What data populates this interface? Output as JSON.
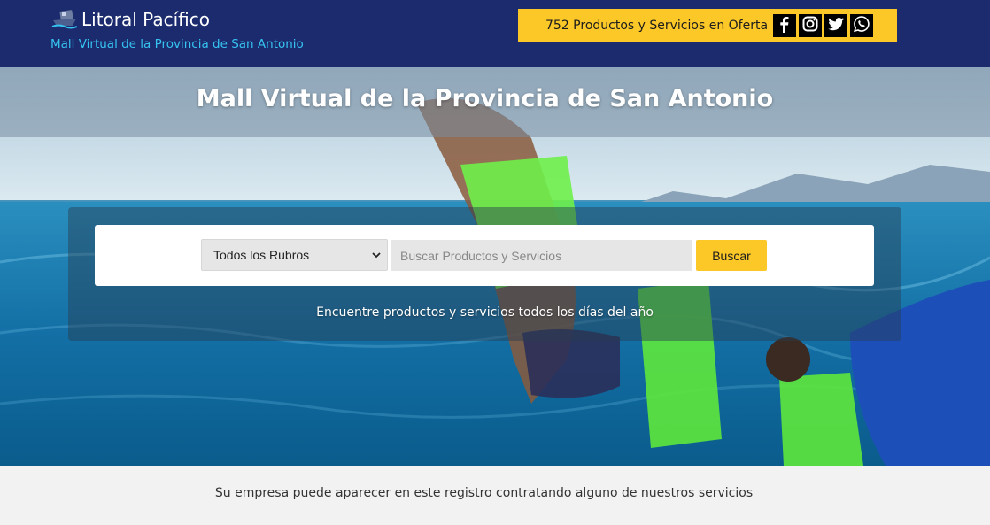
{
  "header": {
    "brand_title": "Litoral Pacífico",
    "brand_subtitle": "Mall Virtual de la Provincia de San Antonio",
    "offer_text": "752 Productos y Servicios en Oferta",
    "social": [
      {
        "icon": "facebook-icon"
      },
      {
        "icon": "instagram-icon"
      },
      {
        "icon": "twitter-icon"
      },
      {
        "icon": "whatsapp-icon"
      }
    ]
  },
  "hero": {
    "title": "Mall Virtual de la Provincia de San Antonio",
    "search": {
      "category_selected": "Todos los Rubros",
      "placeholder": "Buscar Productos y Servicios",
      "button_label": "Buscar"
    },
    "caption": "Encuentre productos y servicios todos los días del año"
  },
  "footer": {
    "text": "Su empresa puede aparecer en este registro contratando alguno de nuestros servicios"
  },
  "colors": {
    "header_bg": "#1b2b6e",
    "accent_yellow": "#fcc828",
    "subtitle_cyan": "#36c3f0"
  }
}
